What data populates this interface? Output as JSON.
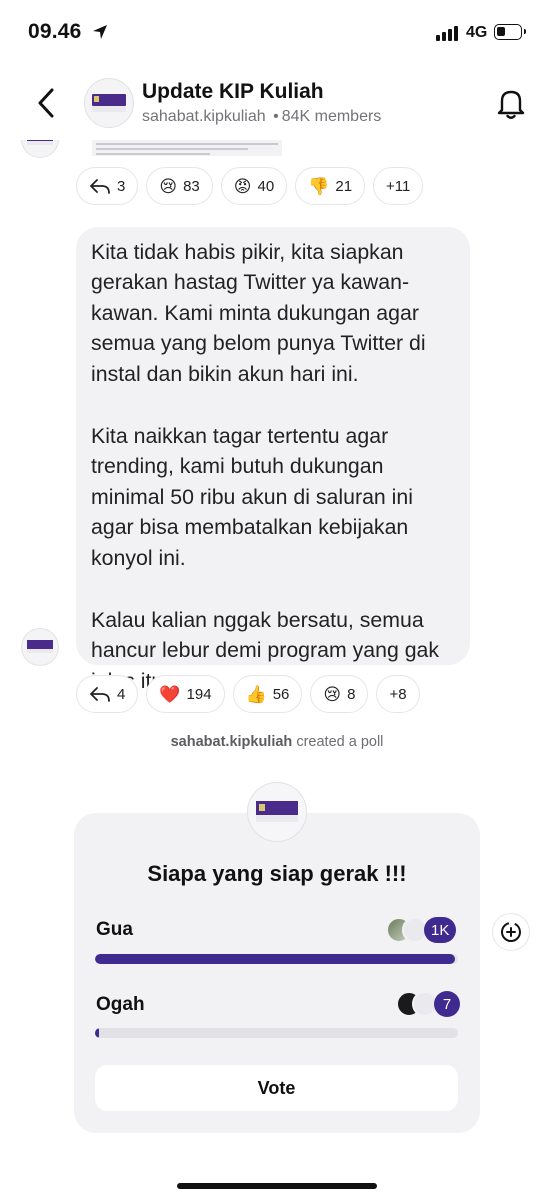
{
  "status_bar": {
    "time": "09.46",
    "network": "4G"
  },
  "header": {
    "title": "Update KIP Kuliah",
    "handle": "sahabat.kipkuliah",
    "separator": "•",
    "members": "84K members"
  },
  "message_1": {
    "reactions": [
      {
        "icon": "reply-icon",
        "emoji": "",
        "count": "3"
      },
      {
        "icon": "crying-face-emoji",
        "emoji": "😢",
        "count": "83"
      },
      {
        "icon": "angry-face-emoji",
        "emoji": "😡",
        "count": "40"
      },
      {
        "icon": "thumbs-down-emoji",
        "emoji": "👎",
        "count": "21"
      },
      {
        "icon": "",
        "emoji": "",
        "count": "+11"
      }
    ]
  },
  "message_2": {
    "paragraphs": [
      "Kita tidak habis pikir, kita siapkan gerakan hastag Twitter ya kawan-kawan. Kami minta dukungan agar semua yang belom punya Twitter di instal dan bikin akun hari ini.",
      "Kita naikkan tagar tertentu agar trending, kami butuh dukungan minimal 50 ribu akun di saluran ini agar bisa membatalkan kebijakan konyol ini.",
      "Kalau kalian nggak bersatu, semua hancur lebur demi program yang gak jelas itu."
    ],
    "reactions": [
      {
        "icon": "reply-icon",
        "emoji": "",
        "count": "4"
      },
      {
        "icon": "heart-emoji",
        "emoji": "❤️",
        "count": "194"
      },
      {
        "icon": "thumbs-up-emoji",
        "emoji": "👍",
        "count": "56"
      },
      {
        "icon": "crying-face-emoji",
        "emoji": "😢",
        "count": "8"
      },
      {
        "icon": "",
        "emoji": "",
        "count": "+8"
      }
    ]
  },
  "system_note": {
    "user": "sahabat.kipkuliah",
    "action": "created a poll"
  },
  "poll": {
    "question": "Siapa yang siap gerak !!!",
    "options": [
      {
        "label": "Gua",
        "count": "1K",
        "fraction": 0.993
      },
      {
        "label": "Ogah",
        "count": "7",
        "fraction": 0.007
      }
    ],
    "vote_label": "Vote"
  },
  "colors": {
    "accent": "#3f2a8f",
    "bubble": "#f2f2f5",
    "muted_text": "#737378"
  }
}
